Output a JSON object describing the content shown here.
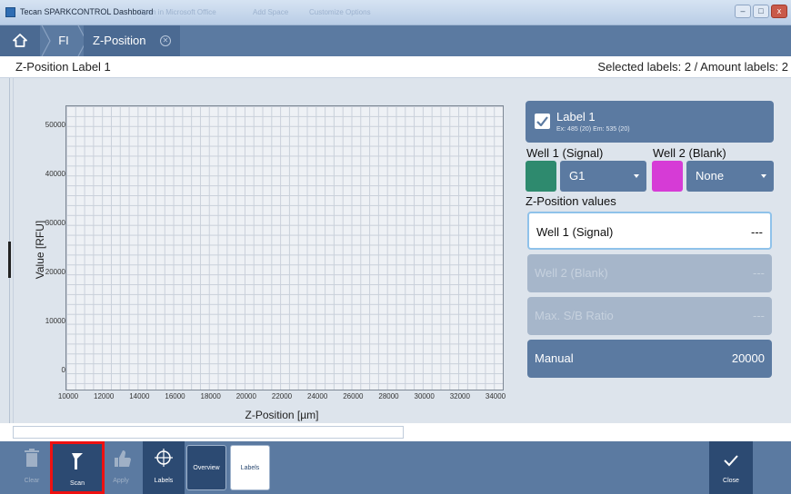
{
  "window": {
    "title": "Tecan SPARKCONTROL Dashboard",
    "ghost_items": [
      "Open in Microsoft Office",
      "Add Space",
      "Customize Options"
    ],
    "controls": [
      "–",
      "□",
      "x"
    ]
  },
  "nav": {
    "home_icon": "home-icon",
    "crumb_fl": "FI",
    "active_tab": "Z-Position"
  },
  "header": {
    "title": "Z-Position Label 1",
    "status": "Selected labels: 2 / Amount labels: 2"
  },
  "chart_data": {
    "type": "scatter",
    "title": "",
    "xlabel": "Z-Position [µm]",
    "ylabel": "Value [RFU]",
    "xlim": [
      10000,
      34000
    ],
    "ylim": [
      0,
      50000
    ],
    "x_ticks": [
      "10000",
      "12000",
      "14000",
      "16000",
      "18000",
      "20000",
      "22000",
      "24000",
      "26000",
      "28000",
      "30000",
      "32000",
      "34000"
    ],
    "y_ticks": [
      "50000",
      "40000",
      "30000",
      "20000",
      "10000",
      "0"
    ],
    "grid": true,
    "series": []
  },
  "panel": {
    "label_name": "Label 1",
    "label_sub": "Ex: 485 (20) Em: 535 (20)",
    "label_checked": true,
    "well1_label": "Well 1 (Signal)",
    "well1_color": "#2e8a6e",
    "well1_value": "G1",
    "well2_label": "Well 2 (Blank)",
    "well2_color": "#d63bd6",
    "well2_value": "None",
    "zpos_heading": "Z-Position values",
    "rows": [
      {
        "key": "Well 1 (Signal)",
        "value": "---"
      },
      {
        "key": "Well 2 (Blank)",
        "value": "---"
      },
      {
        "key": "Max. S/B Ratio",
        "value": "---"
      },
      {
        "key": "Manual",
        "value": "20000"
      }
    ]
  },
  "toolbar": {
    "clear": "Clear",
    "scan": "Scan",
    "apply": "Apply",
    "labels": "Labels",
    "overview": "Overview",
    "labels_view": "Labels",
    "close": "Close"
  }
}
